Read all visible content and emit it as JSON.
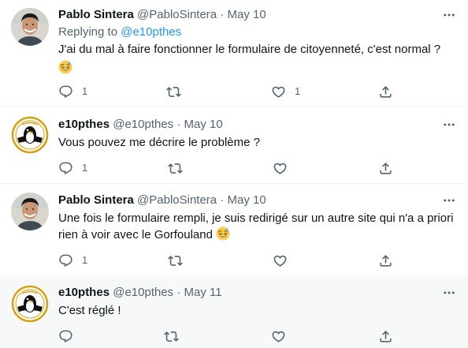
{
  "tweets": [
    {
      "name": "Pablo Sintera",
      "handle": "@PabloSintera",
      "separator": "·",
      "date": "May 10",
      "replying_prefix": "Replying to",
      "replying_to": "@e10pthes",
      "text_line1": "J'ai du mal à faire fonctionner le formulaire de citoyenneté, c'est normal ?",
      "emoji": "sweat-smile",
      "reply_count": "1",
      "retweet_count": "",
      "like_count": "1"
    },
    {
      "name": "e10pthes",
      "handle": "@e10pthes",
      "separator": "·",
      "date": "May 10",
      "text": "Vous pouvez me décrire le problème ?",
      "reply_count": "1",
      "retweet_count": "",
      "like_count": ""
    },
    {
      "name": "Pablo Sintera",
      "handle": "@PabloSintera",
      "separator": "·",
      "date": "May 10",
      "text_line1": "Une fois le formulaire rempli, je suis redirigé sur un autre site qui n'a a priori",
      "text_line2": "rien à voir avec le Gorfouland",
      "emoji": "sweat-smile",
      "reply_count": "1",
      "retweet_count": "",
      "like_count": ""
    },
    {
      "name": "e10pthes",
      "handle": "@e10pthes",
      "separator": "·",
      "date": "May 11",
      "text": "C'est réglé !",
      "reply_count": "",
      "retweet_count": "",
      "like_count": ""
    }
  ],
  "icons": {
    "more": "more-horizontal-icon",
    "reply": "reply-icon",
    "retweet": "retweet-icon",
    "like": "heart-icon",
    "share": "share-icon"
  },
  "colors": {
    "text": "#0f1419",
    "secondary": "#536471",
    "link": "#1d9bf0",
    "highlight_bg": "#f7f9f9"
  }
}
